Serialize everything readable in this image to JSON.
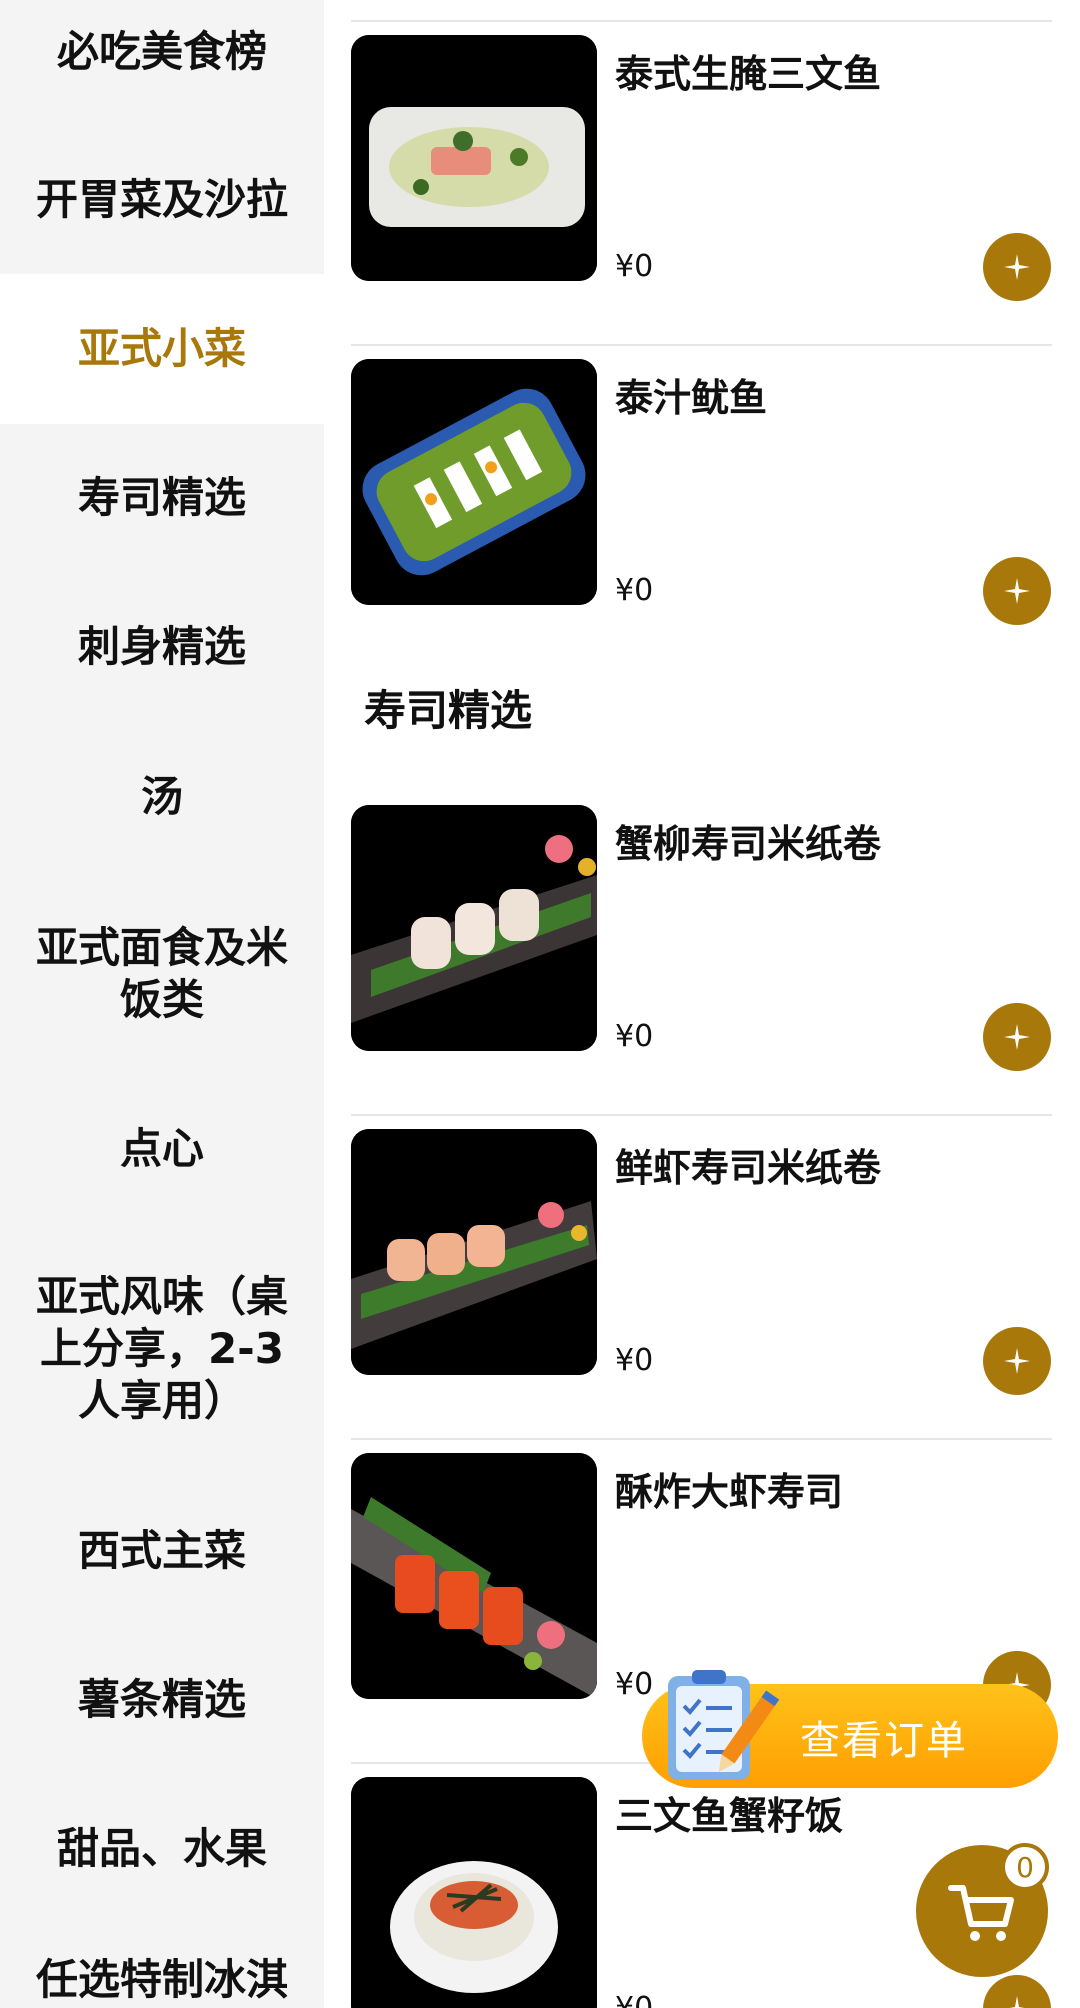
{
  "sidebar": {
    "categories": [
      {
        "label": "必吃美食榜"
      },
      {
        "label": "开胃菜及沙拉"
      },
      {
        "label": "亚式小菜"
      },
      {
        "label": "寿司精选"
      },
      {
        "label": "刺身精选"
      },
      {
        "label": "汤"
      },
      {
        "label": "亚式面食及米饭类"
      },
      {
        "label": "点心"
      },
      {
        "label": "亚式风味（桌上分享，2-3人享用）"
      },
      {
        "label": "西式主菜"
      },
      {
        "label": "薯条精选"
      },
      {
        "label": "甜品、水果"
      },
      {
        "label": "任选特制冰淇"
      }
    ],
    "active": "亚式小菜"
  },
  "menu": {
    "section_title": "寿司精选",
    "items": [
      {
        "name": "泰式生腌三文鱼",
        "price": "¥0"
      },
      {
        "name": "泰汁鱿鱼",
        "price": "¥0"
      },
      {
        "name": "蟹柳寿司米纸卷",
        "price": "¥0"
      },
      {
        "name": "鲜虾寿司米纸卷",
        "price": "¥0"
      },
      {
        "name": "酥炸大虾寿司",
        "price": "¥0"
      },
      {
        "name": "三文鱼蟹籽饭",
        "price": "¥0"
      }
    ]
  },
  "floating": {
    "order_label": "查看订单",
    "cart_count": "0"
  },
  "colors": {
    "accent": "#a8780b",
    "order_gradient_top": "#ffc21a",
    "order_gradient_bottom": "#ff9f00",
    "sidebar_bg": "#f4f4f4"
  },
  "icons": [
    "plus-icon",
    "checklist-pencil-icon",
    "cart-icon"
  ]
}
